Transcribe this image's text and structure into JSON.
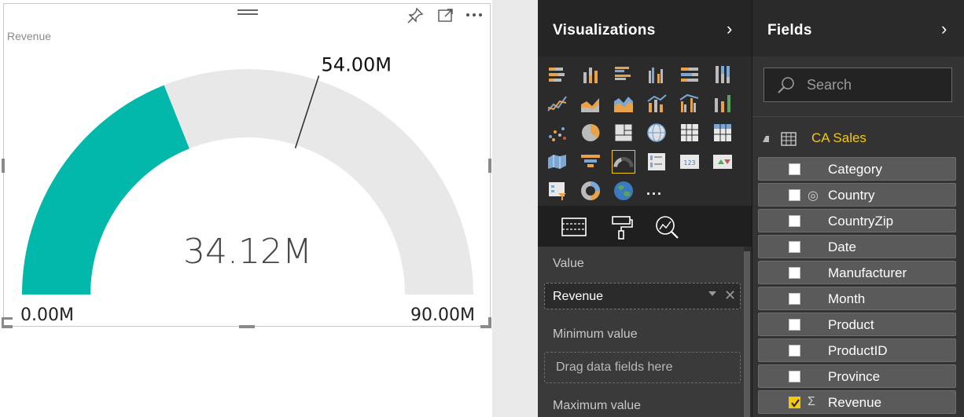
{
  "visual": {
    "title": "Revenue",
    "gauge": {
      "value_label": "34.12M",
      "min_label": "0.00M",
      "max_label": "90.00M",
      "target_label": "54.00M",
      "value": 34.12,
      "min": 0,
      "max": 90,
      "target": 54,
      "fill_color": "#01b8aa",
      "track_color": "#e8e8e8"
    }
  },
  "visualizations_pane": {
    "title": "Visualizations",
    "more_label": "...",
    "selected_icon": "gauge-icon",
    "icons": [
      "stacked-bar-chart-icon",
      "stacked-column-chart-icon",
      "clustered-bar-chart-icon",
      "clustered-column-chart-icon",
      "100-stacked-bar-chart-icon",
      "100-stacked-column-chart-icon",
      "line-chart-icon",
      "area-chart-icon",
      "stacked-area-chart-icon",
      "line-and-stacked-column-icon",
      "line-and-clustered-column-icon",
      "ribbon-chart-icon",
      "scatter-chart-icon",
      "pie-chart-icon",
      "treemap-icon",
      "map-icon",
      "table-icon",
      "matrix-icon",
      "filled-map-icon",
      "funnel-icon",
      "gauge-icon",
      "multi-row-card-icon",
      "card-icon",
      "kpi-icon",
      "slicer-icon",
      "donut-chart-icon",
      "globe-icon"
    ],
    "tabs": [
      "fields-tab-icon",
      "format-tab-icon",
      "analytics-tab-icon"
    ],
    "wells": {
      "value_label": "Value",
      "value_field": "Revenue",
      "minimum_label": "Minimum value",
      "minimum_placeholder": "Drag data fields here",
      "maximum_label": "Maximum value"
    },
    "accent_color": "#f2c811"
  },
  "fields_pane": {
    "title": "Fields",
    "search_placeholder": "Search",
    "table_name": "CA Sales",
    "fields": [
      {
        "label": "Category",
        "checked": false,
        "glyph": ""
      },
      {
        "label": "Country",
        "checked": false,
        "glyph": "globe-icon"
      },
      {
        "label": "CountryZip",
        "checked": false,
        "glyph": ""
      },
      {
        "label": "Date",
        "checked": false,
        "glyph": ""
      },
      {
        "label": "Manufacturer",
        "checked": false,
        "glyph": ""
      },
      {
        "label": "Month",
        "checked": false,
        "glyph": ""
      },
      {
        "label": "Product",
        "checked": false,
        "glyph": ""
      },
      {
        "label": "ProductID",
        "checked": false,
        "glyph": ""
      },
      {
        "label": "Province",
        "checked": false,
        "glyph": ""
      },
      {
        "label": "Revenue",
        "checked": true,
        "glyph": "sigma-icon"
      }
    ]
  }
}
